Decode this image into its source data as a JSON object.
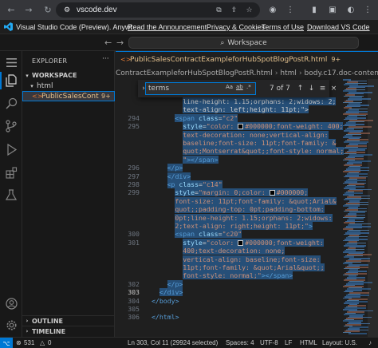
{
  "browser": {
    "url": "vscode.dev",
    "back_icon": "←",
    "forward_icon": "→",
    "reload_icon": "↻"
  },
  "banner": {
    "title": "Visual Studio Code (Preview). Anywh...",
    "links": [
      "Read the Announcement",
      "Privacy & Cookies",
      "Terms of Use",
      "Download VS Code"
    ]
  },
  "titlebar": {
    "command_center": "Workspace"
  },
  "sidebar": {
    "title": "EXPLORER",
    "workspace": "WORKSPACE",
    "folder": "html",
    "file": "PublicSalesContr...",
    "file_badge": "9+",
    "outline": "OUTLINE",
    "timeline": "TIMELINE"
  },
  "editor": {
    "tab": {
      "label": "PublicSalesContractExampleforHubSpotBlogPostR.html",
      "badge": "9+"
    },
    "breadcrumbs": [
      "ContractExampleforHubSpotBlogPostR.html",
      "html",
      "body.c17.doc-content",
      "div"
    ],
    "find": {
      "query": "terms",
      "options": [
        "Aa",
        "ab",
        ".*"
      ],
      "count": "7 of 7"
    },
    "lines": [
      {
        "num": "",
        "indent": 4,
        "parts": [
          {
            "t": "txt",
            "v": "line-height: 1.15;orphans: 2;widows: 2;"
          }
        ]
      },
      {
        "num": "",
        "indent": 4,
        "parts": [
          {
            "t": "txt",
            "v": "text-align: left;height: 11pt;\">"
          }
        ]
      },
      {
        "num": "294",
        "indent": 3,
        "parts": [
          {
            "t": "tag",
            "v": "<span "
          },
          {
            "t": "attr",
            "v": "class"
          },
          {
            "t": "txt",
            "v": "="
          },
          {
            "t": "str",
            "v": "\"c2\""
          }
        ]
      },
      {
        "num": "295",
        "indent": 4,
        "parts": [
          {
            "t": "attr",
            "v": "style"
          },
          {
            "t": "txt",
            "v": "="
          },
          {
            "t": "str",
            "v": "\"color: "
          },
          {
            "t": "swatch",
            "v": ""
          },
          {
            "t": "str",
            "v": "#000000;font-weight: 400;"
          }
        ]
      },
      {
        "num": "",
        "indent": 4,
        "parts": [
          {
            "t": "str",
            "v": "text-decoration: none;vertical-align:"
          }
        ]
      },
      {
        "num": "",
        "indent": 4,
        "parts": [
          {
            "t": "str",
            "v": "baseline;font-size: 11pt;font-family: &"
          }
        ]
      },
      {
        "num": "",
        "indent": 4,
        "parts": [
          {
            "t": "str",
            "v": "quot;Montserrat&quot;;font-style: normal;"
          }
        ]
      },
      {
        "num": "",
        "indent": 4,
        "parts": [
          {
            "t": "str",
            "v": "\""
          },
          {
            "t": "tag",
            "v": "></span>"
          }
        ]
      },
      {
        "num": "296",
        "indent": 2,
        "parts": [
          {
            "t": "tag",
            "v": "</p>"
          }
        ]
      },
      {
        "num": "297",
        "indent": 2,
        "parts": [
          {
            "t": "tag",
            "v": "</div>"
          }
        ]
      },
      {
        "num": "298",
        "indent": 2,
        "parts": [
          {
            "t": "tag",
            "v": "<p "
          },
          {
            "t": "attr",
            "v": "class"
          },
          {
            "t": "txt",
            "v": "="
          },
          {
            "t": "str",
            "v": "\"c14\""
          }
        ]
      },
      {
        "num": "299",
        "indent": 3,
        "parts": [
          {
            "t": "attr",
            "v": "style"
          },
          {
            "t": "txt",
            "v": "="
          },
          {
            "t": "str",
            "v": "\"margin: 0;color: "
          },
          {
            "t": "swatch",
            "v": ""
          },
          {
            "t": "str",
            "v": "#000000;"
          }
        ]
      },
      {
        "num": "",
        "indent": 3,
        "parts": [
          {
            "t": "str",
            "v": "font-size: 11pt;font-family: &quot;Arial&"
          }
        ]
      },
      {
        "num": "",
        "indent": 3,
        "parts": [
          {
            "t": "str",
            "v": "quot;;padding-top: 0pt;padding-bottom:"
          }
        ]
      },
      {
        "num": "",
        "indent": 3,
        "parts": [
          {
            "t": "str",
            "v": "0pt;line-height: 1.15;orphans: 2;widows:"
          }
        ]
      },
      {
        "num": "",
        "indent": 3,
        "parts": [
          {
            "t": "str",
            "v": "2;text-align: right;height: 11pt;\""
          },
          {
            "t": "tag",
            "v": ">"
          }
        ]
      },
      {
        "num": "300",
        "indent": 3,
        "parts": [
          {
            "t": "tag",
            "v": "<span "
          },
          {
            "t": "attr",
            "v": "class"
          },
          {
            "t": "txt",
            "v": "="
          },
          {
            "t": "str",
            "v": "\"c20\""
          }
        ]
      },
      {
        "num": "301",
        "indent": 4,
        "parts": [
          {
            "t": "attr",
            "v": "style"
          },
          {
            "t": "txt",
            "v": "="
          },
          {
            "t": "str",
            "v": "\"color: "
          },
          {
            "t": "swatch",
            "v": ""
          },
          {
            "t": "str",
            "v": "#000000;font-weight:"
          }
        ]
      },
      {
        "num": "",
        "indent": 4,
        "parts": [
          {
            "t": "str",
            "v": "400;text-decoration: none;"
          }
        ]
      },
      {
        "num": "",
        "indent": 4,
        "parts": [
          {
            "t": "str",
            "v": "vertical-align: baseline;font-size:"
          }
        ]
      },
      {
        "num": "",
        "indent": 4,
        "parts": [
          {
            "t": "str",
            "v": "11pt;font-family: &quot;Arial&quot;;"
          }
        ]
      },
      {
        "num": "",
        "indent": 4,
        "parts": [
          {
            "t": "str",
            "v": "font-style: normal;\""
          },
          {
            "t": "tag",
            "v": "></span>"
          }
        ]
      },
      {
        "num": "302",
        "indent": 2,
        "parts": [
          {
            "t": "tag",
            "v": "</p>"
          }
        ]
      },
      {
        "num": "303",
        "indent": 1,
        "parts": [
          {
            "t": "tag",
            "v": "</div>"
          }
        ]
      },
      {
        "num": "304",
        "indent": 0,
        "parts": [
          {
            "t": "tag",
            "v": "</body>"
          }
        ]
      },
      {
        "num": "305",
        "indent": 0,
        "parts": []
      },
      {
        "num": "306",
        "indent": 0,
        "parts": [
          {
            "t": "tag",
            "v": "</html>"
          }
        ]
      }
    ],
    "current_line": "303",
    "selection_end_line": "303"
  },
  "statusbar": {
    "problems": "531",
    "warnings": "0",
    "position": "Ln 303, Col 11 (29924 selected)",
    "spaces": "Spaces: 4",
    "encoding": "UTF-8",
    "eol": "LF",
    "language": "HTML",
    "layout": "Layout: U.S."
  },
  "colors": {
    "accent": "#0078d4",
    "selection": "#264f78",
    "tag": "#569cd6",
    "attr": "#9cdcfe",
    "string": "#ce9178",
    "modified_file": "#e2c08d"
  }
}
